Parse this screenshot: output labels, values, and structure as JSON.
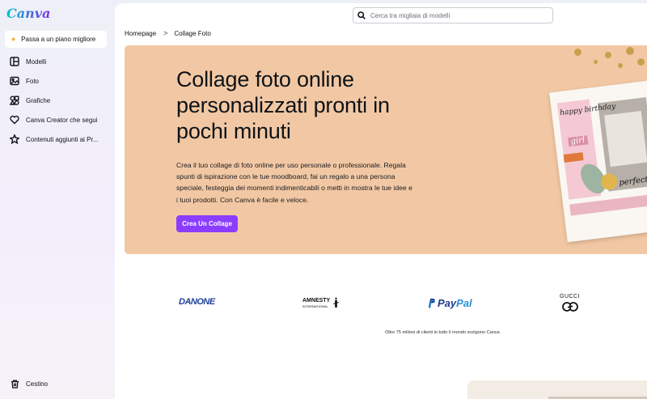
{
  "brand": {
    "logo_text": "Canva"
  },
  "sidebar": {
    "upgrade_label": "Passa a un piano migliore",
    "items": [
      {
        "label": "Modelli",
        "icon": "templates-icon"
      },
      {
        "label": "Foto",
        "icon": "photo-icon"
      },
      {
        "label": "Grafiche",
        "icon": "graphics-icon"
      },
      {
        "label": "Canva Creator che segui",
        "icon": "heart-icon"
      },
      {
        "label": "Contenuti aggiunti ai Pr...",
        "icon": "star-icon"
      }
    ],
    "trash_label": "Cestino"
  },
  "search": {
    "placeholder": "Cerca tra migliaia di modelli",
    "value": ""
  },
  "breadcrumb": {
    "home": "Homepage",
    "separator": ">",
    "current": "Collage Foto"
  },
  "hero": {
    "title": "Collage foto online personalizzati pronti in pochi minuti",
    "description": "Crea il tuo collage di foto online per uso personale o professionale. Regala spunti di ispirazione con le tue moodboard, fai un regalo a una persona speciale, festeggia dei momenti indimenticabili o metti in mostra le tue idee e i tuoi prodotti. Con Canva è facile e veloce.",
    "cta_label": "Crea Un Collage",
    "background_color": "#f2c8a4",
    "cta_color": "#8b3dff",
    "collage": {
      "word1": "happy birthday",
      "word2": "girl",
      "word3": "perfect"
    }
  },
  "logos": {
    "danone": "DANONE",
    "amnesty": "AMNESTY",
    "amnesty_sub": "INTERNATIONAL",
    "paypal_a": "Pay",
    "paypal_b": "Pal",
    "gucci": "GUCCI"
  },
  "clients_text": "Oltre 75 milioni di clienti in tutto il mondo scelgono Canva"
}
